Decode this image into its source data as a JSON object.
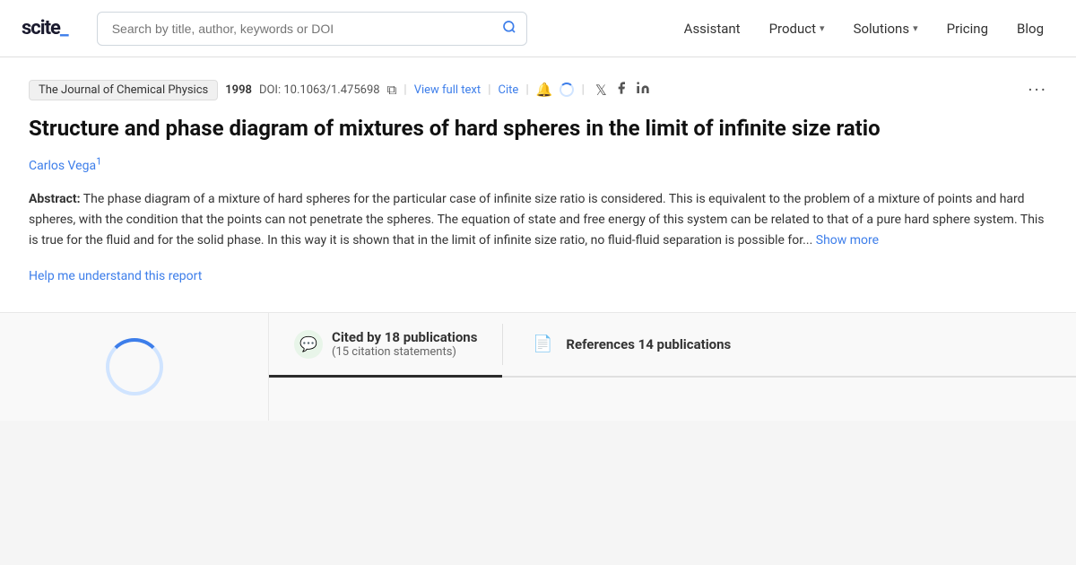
{
  "header": {
    "logo": "scite_",
    "search": {
      "placeholder": "Search by title, author, keywords or DOI",
      "value": ""
    },
    "nav": [
      {
        "id": "assistant",
        "label": "Assistant",
        "hasDropdown": false
      },
      {
        "id": "product",
        "label": "Product",
        "hasDropdown": true
      },
      {
        "id": "solutions",
        "label": "Solutions",
        "hasDropdown": true
      },
      {
        "id": "pricing",
        "label": "Pricing",
        "hasDropdown": false
      },
      {
        "id": "blog",
        "label": "Blog",
        "hasDropdown": false
      }
    ]
  },
  "article": {
    "journal": "The Journal of Chemical Physics",
    "year": "1998",
    "doi_label": "DOI:",
    "doi": "10.1063/1.475698",
    "view_full_text": "View full text",
    "cite": "Cite",
    "title": "Structure and phase diagram of mixtures of hard spheres in the limit of infinite size ratio",
    "author": "Carlos Vega",
    "author_sup": "1",
    "abstract_label": "Abstract:",
    "abstract_text": "The phase diagram of a mixture of hard spheres for the particular case of infinite size ratio is considered. This is equivalent to the problem of a mixture of points and hard spheres, with the condition that the points can not penetrate the spheres. The equation of state and free energy of this system can be related to that of a pure hard sphere system. This is true for the fluid and for the solid phase. In this way it is shown that in the limit of infinite size ratio, no fluid-fluid separation is possible for...",
    "show_more": "Show more",
    "help_link": "Help me understand this report"
  },
  "tabs": {
    "cited_by": {
      "label_main": "Cited by 18 publications",
      "label_count": "18",
      "citations_sub": "(15 citation statements)",
      "icon": "💬"
    },
    "references": {
      "label": "References 14 publications",
      "icon": "📄"
    }
  }
}
